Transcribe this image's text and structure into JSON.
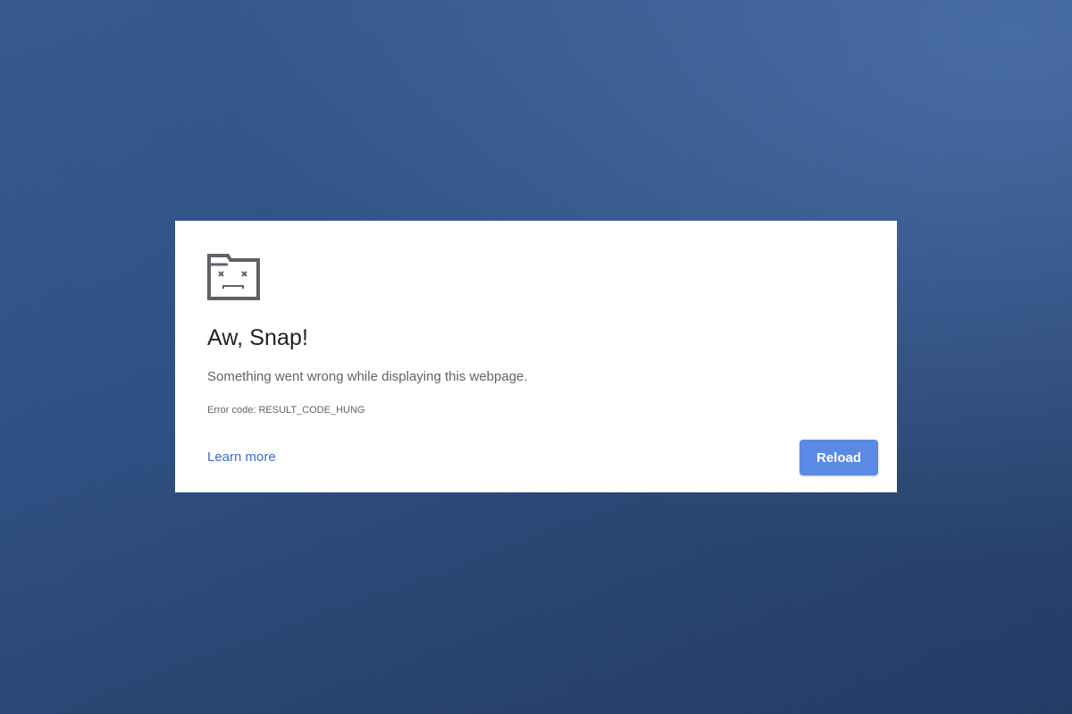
{
  "error_page": {
    "icon": "sad-tab-icon",
    "title": "Aw, Snap!",
    "message": "Something went wrong while displaying this webpage.",
    "error_code": "Error code: RESULT_CODE_HUNG",
    "learn_more_label": "Learn more",
    "reload_label": "Reload"
  },
  "colors": {
    "accent_button": "#5a8ae6",
    "link": "#3b6cc7",
    "title_text": "#202124",
    "secondary_text": "#5f6368",
    "background": "#2f4f82"
  }
}
